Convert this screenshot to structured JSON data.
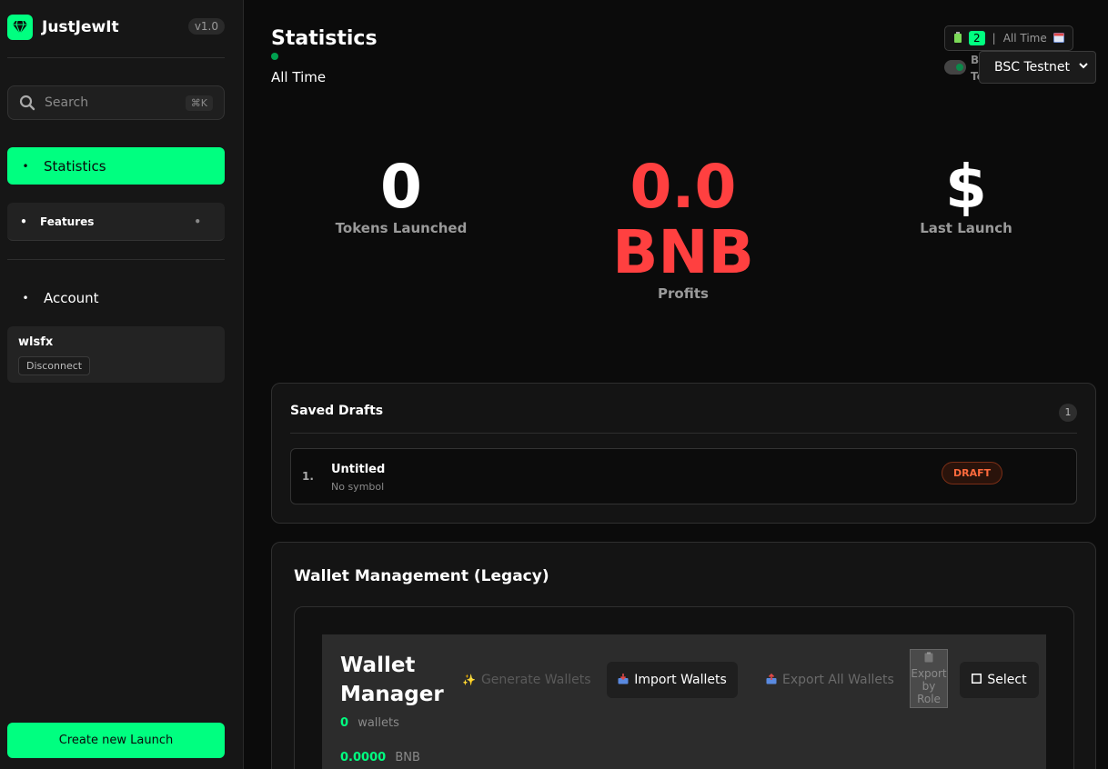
{
  "app": {
    "name": "JustJewIt",
    "version": "v1.0"
  },
  "sidebar": {
    "search_placeholder": "Search",
    "search_shortcut": "⌘K",
    "items": [
      {
        "label": "Statistics",
        "active": true
      },
      {
        "label": "Features"
      },
      {
        "label": "Account"
      }
    ],
    "user": {
      "name": "wlsfx",
      "disconnect_label": "Disconnect"
    },
    "create_label": "Create new Launch"
  },
  "header": {
    "title": "Statistics",
    "period": "All Time",
    "range_count": "2",
    "range_label": "All Time",
    "toggle_label": "BSC Testnet",
    "network_selected": "BSC Testnet"
  },
  "stats": [
    {
      "value": "0",
      "label": "Tokens Launched"
    },
    {
      "value": "0.0 BNB",
      "value_line1": "0.0",
      "value_line2": "BNB",
      "label": "Profits"
    },
    {
      "value": "$",
      "label": "Last Launch"
    }
  ],
  "drafts": {
    "title": "Saved Drafts",
    "count": "1",
    "items": [
      {
        "index": "1.",
        "name": "Untitled",
        "symbol": "No symbol",
        "status": "DRAFT"
      }
    ]
  },
  "wallet": {
    "section_title": "Wallet Management (Legacy)",
    "manager_title_line1": "Wallet",
    "manager_title_line2": "Manager",
    "wallet_count": "0",
    "wallet_count_label": "wallets",
    "balance": "0.0000",
    "balance_unit": "BNB",
    "buttons": {
      "generate": "Generate Wallets",
      "import": "Import Wallets",
      "export_all": "Export All Wallets",
      "export_role_1": "Export",
      "export_role_2": "by",
      "export_role_3": "Role",
      "select": "Select"
    }
  },
  "colors": {
    "accent": "#00ff80",
    "profit": "#ff4040",
    "draft": "#ff6a3d"
  }
}
